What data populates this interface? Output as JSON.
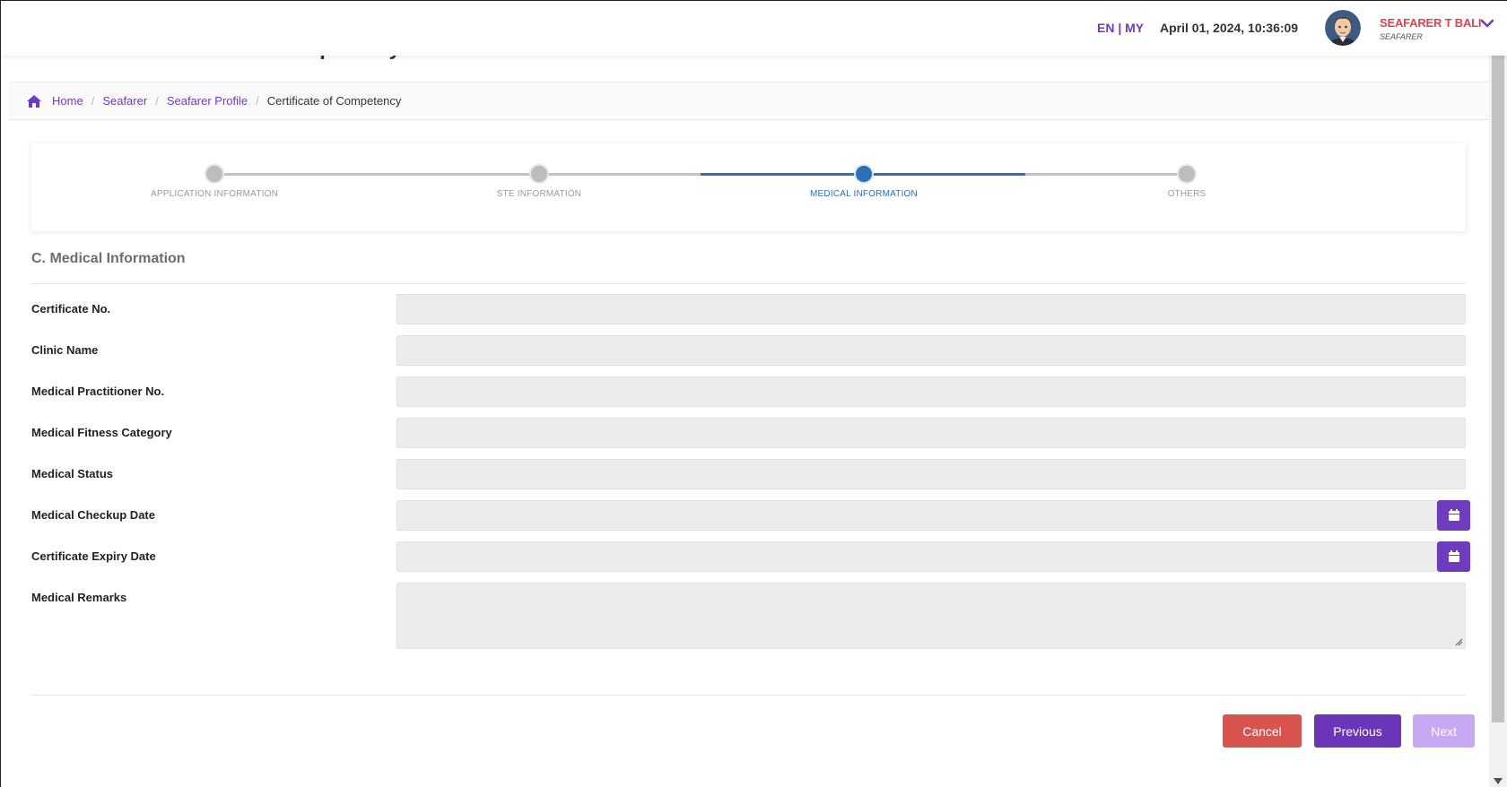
{
  "header": {
    "lang_label": "EN | MY",
    "datetime": "April 01, 2024, 10:36:09",
    "user_name": "SEAFARER T BALI",
    "user_role": "SEAFARER"
  },
  "page": {
    "title": "Seafarer - Certificate of Competency"
  },
  "breadcrumb": {
    "home": "Home",
    "seafarer": "Seafarer",
    "profile": "Seafarer Profile",
    "current": "Certificate of Competency"
  },
  "stepper": {
    "steps": [
      {
        "label": "APPLICATION INFORMATION"
      },
      {
        "label": "STE INFORMATION"
      },
      {
        "label": "MEDICAL INFORMATION"
      },
      {
        "label": "OTHERS"
      }
    ],
    "active_step": "MEDICAL INFORMATION"
  },
  "section": {
    "title": "C. Medical Information"
  },
  "form": {
    "certificate_no": {
      "label": "Certificate No.",
      "value": ""
    },
    "clinic_name": {
      "label": "Clinic Name",
      "value": ""
    },
    "practitioner_no": {
      "label": "Medical Practitioner No.",
      "value": ""
    },
    "fitness_category": {
      "label": "Medical Fitness Category",
      "value": ""
    },
    "medical_status": {
      "label": "Medical Status",
      "value": ""
    },
    "checkup_date": {
      "label": "Medical Checkup Date",
      "value": ""
    },
    "expiry_date": {
      "label": "Certificate Expiry Date",
      "value": ""
    },
    "remarks": {
      "label": "Medical Remarks",
      "value": ""
    }
  },
  "actions": {
    "cancel": "Cancel",
    "previous": "Previous",
    "next": "Next"
  },
  "colors": {
    "brand_purple": "#6f3bbf",
    "cancel_red": "#d9534f",
    "active_step_blue": "#2e6fb5",
    "user_name_red": "#e0424e"
  },
  "icons": {
    "breadcrumb_home": "home-icon",
    "date_picker": "calendar-icon",
    "user_menu": "chevron-down-icon"
  }
}
